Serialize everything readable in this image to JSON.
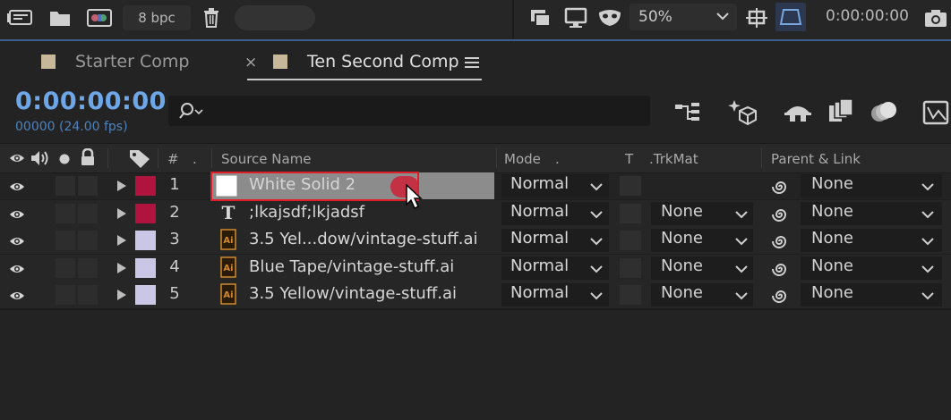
{
  "toolbar": {
    "bpc_label": "8 bpc",
    "zoom_value": "50%",
    "timecode": "0:00:00:00",
    "icons": [
      "interpret-footage-icon",
      "folder-icon",
      "new-composition-icon",
      "trash-icon",
      "snapshot-icon",
      "monitor-icon",
      "mask-visibility-icon",
      "resolution-icon",
      "region-of-interest-icon",
      "camera-icon"
    ]
  },
  "tabs": [
    {
      "label": "Starter Comp",
      "swatch": "#c8b89a",
      "active": false
    },
    {
      "label": "Ten Second Comp",
      "swatch": "#c8b89a",
      "active": true
    }
  ],
  "comp": {
    "timecode": "0:00:00:00",
    "frames": "00000 (24.00 fps)",
    "search_placeholder": ""
  },
  "columns": {
    "hash": "#",
    "source_name": "Source Name",
    "mode": "Mode",
    "t": "T",
    "trkmat": ".TrkMat",
    "parent": "Parent & Link"
  },
  "layers": [
    {
      "num": "1",
      "name": "White Solid 2",
      "label_color": "#b0143e",
      "type": "solid",
      "mode": "Normal",
      "trkmat": "",
      "parent": "None",
      "selected": true
    },
    {
      "num": "2",
      "name": ";lkajsdf;lkjadsf",
      "label_color": "#b0143e",
      "type": "text",
      "mode": "Normal",
      "trkmat": "None",
      "parent": "None",
      "selected": false
    },
    {
      "num": "3",
      "name": "3.5 Yel...dow/vintage-stuff.ai",
      "label_color": "#c9c6e6",
      "type": "ai",
      "mode": "Normal",
      "trkmat": "None",
      "parent": "None",
      "selected": false
    },
    {
      "num": "4",
      "name": "Blue Tape/vintage-stuff.ai",
      "label_color": "#c9c6e6",
      "type": "ai",
      "mode": "Normal",
      "trkmat": "None",
      "parent": "None",
      "selected": false
    },
    {
      "num": "5",
      "name": "3.5 Yellow/vintage-stuff.ai",
      "label_color": "#c9c6e6",
      "type": "ai",
      "mode": "Normal",
      "trkmat": "None",
      "parent": "None",
      "selected": false
    }
  ],
  "colors": {
    "accent_blue": "#6ea7e8",
    "highlight_red": "#e11d2a",
    "background": "#232323"
  }
}
